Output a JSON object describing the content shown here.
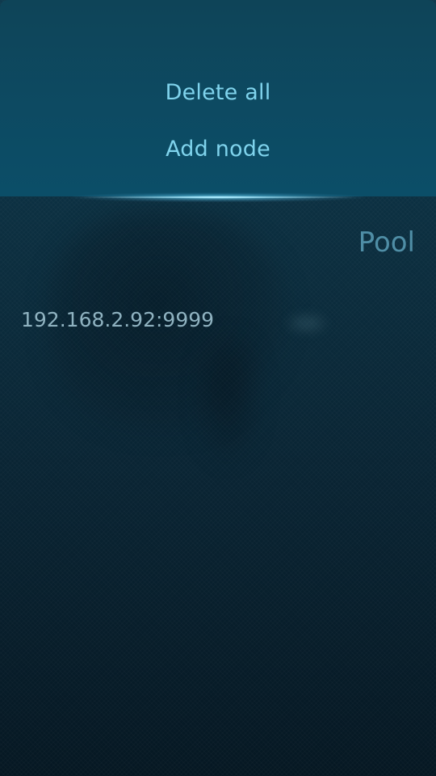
{
  "pulley_menu": {
    "items": [
      {
        "label": "Delete all"
      },
      {
        "label": "Add node"
      }
    ]
  },
  "page": {
    "title": "Pool"
  },
  "nodes": [
    {
      "address": "192.168.2.92:9999"
    }
  ],
  "colors": {
    "menu_text": "#7fd3ec",
    "title_text": "#4f8ea6",
    "list_text": "#8fb2c0",
    "menu_background": "#0d4a62",
    "page_background": "#0a2534"
  }
}
